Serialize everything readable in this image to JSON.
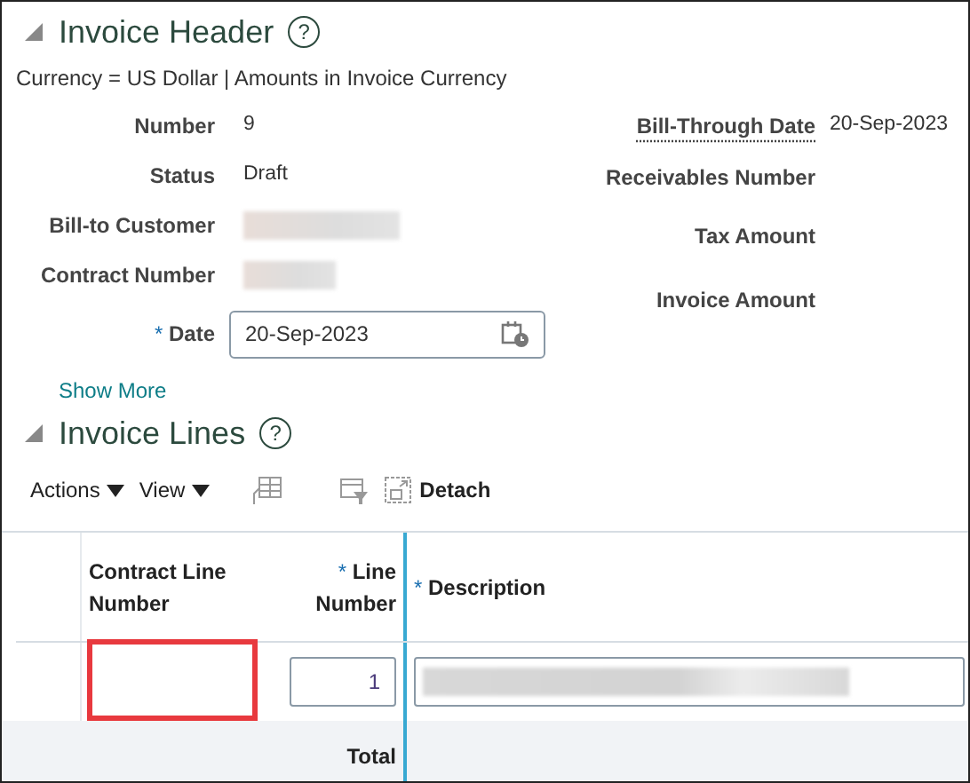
{
  "header": {
    "title": "Invoice Header",
    "help": "?",
    "expanded": true,
    "currency_note": "Currency = US Dollar | Amounts in Invoice Currency",
    "left_fields": [
      {
        "label": "Number",
        "kind": "text",
        "value": "9"
      },
      {
        "label": "Status",
        "kind": "text",
        "value": "Draft"
      },
      {
        "label": "Bill-to Customer",
        "kind": "redacted"
      },
      {
        "label": "Contract Number",
        "kind": "redacted"
      },
      {
        "label": "Date",
        "kind": "date",
        "required_mark": "*",
        "value": "20-Sep-2023"
      }
    ],
    "right_fields": [
      {
        "label": "Bill-Through Date",
        "kind": "text",
        "underlined": true,
        "value": "20-Sep-2023"
      },
      {
        "label": "Receivables Number",
        "kind": "text"
      },
      {
        "label": "Tax Amount",
        "kind": "text"
      },
      {
        "label": "Invoice Amount",
        "kind": "text"
      }
    ],
    "show_more": "Show More"
  },
  "lines": {
    "title": "Invoice Lines",
    "help": "?",
    "expanded": true,
    "toolbar": [
      {
        "label": "Actions",
        "kind": "menu"
      },
      {
        "label": "View",
        "kind": "menu"
      },
      {
        "kind": "freeze"
      },
      {
        "kind": "filter"
      },
      {
        "label": "Detach",
        "kind": "detach"
      }
    ],
    "columns": [
      {
        "label": "Contract Line Number"
      },
      {
        "label": "Line Number",
        "required_mark": "*"
      },
      {
        "label": "Description",
        "required_mark": "*"
      }
    ],
    "rows": [
      {
        "contract_line_number": {
          "highlighted": true
        },
        "line_number": "1",
        "description_redacted": true
      }
    ],
    "total_label": "Total"
  }
}
